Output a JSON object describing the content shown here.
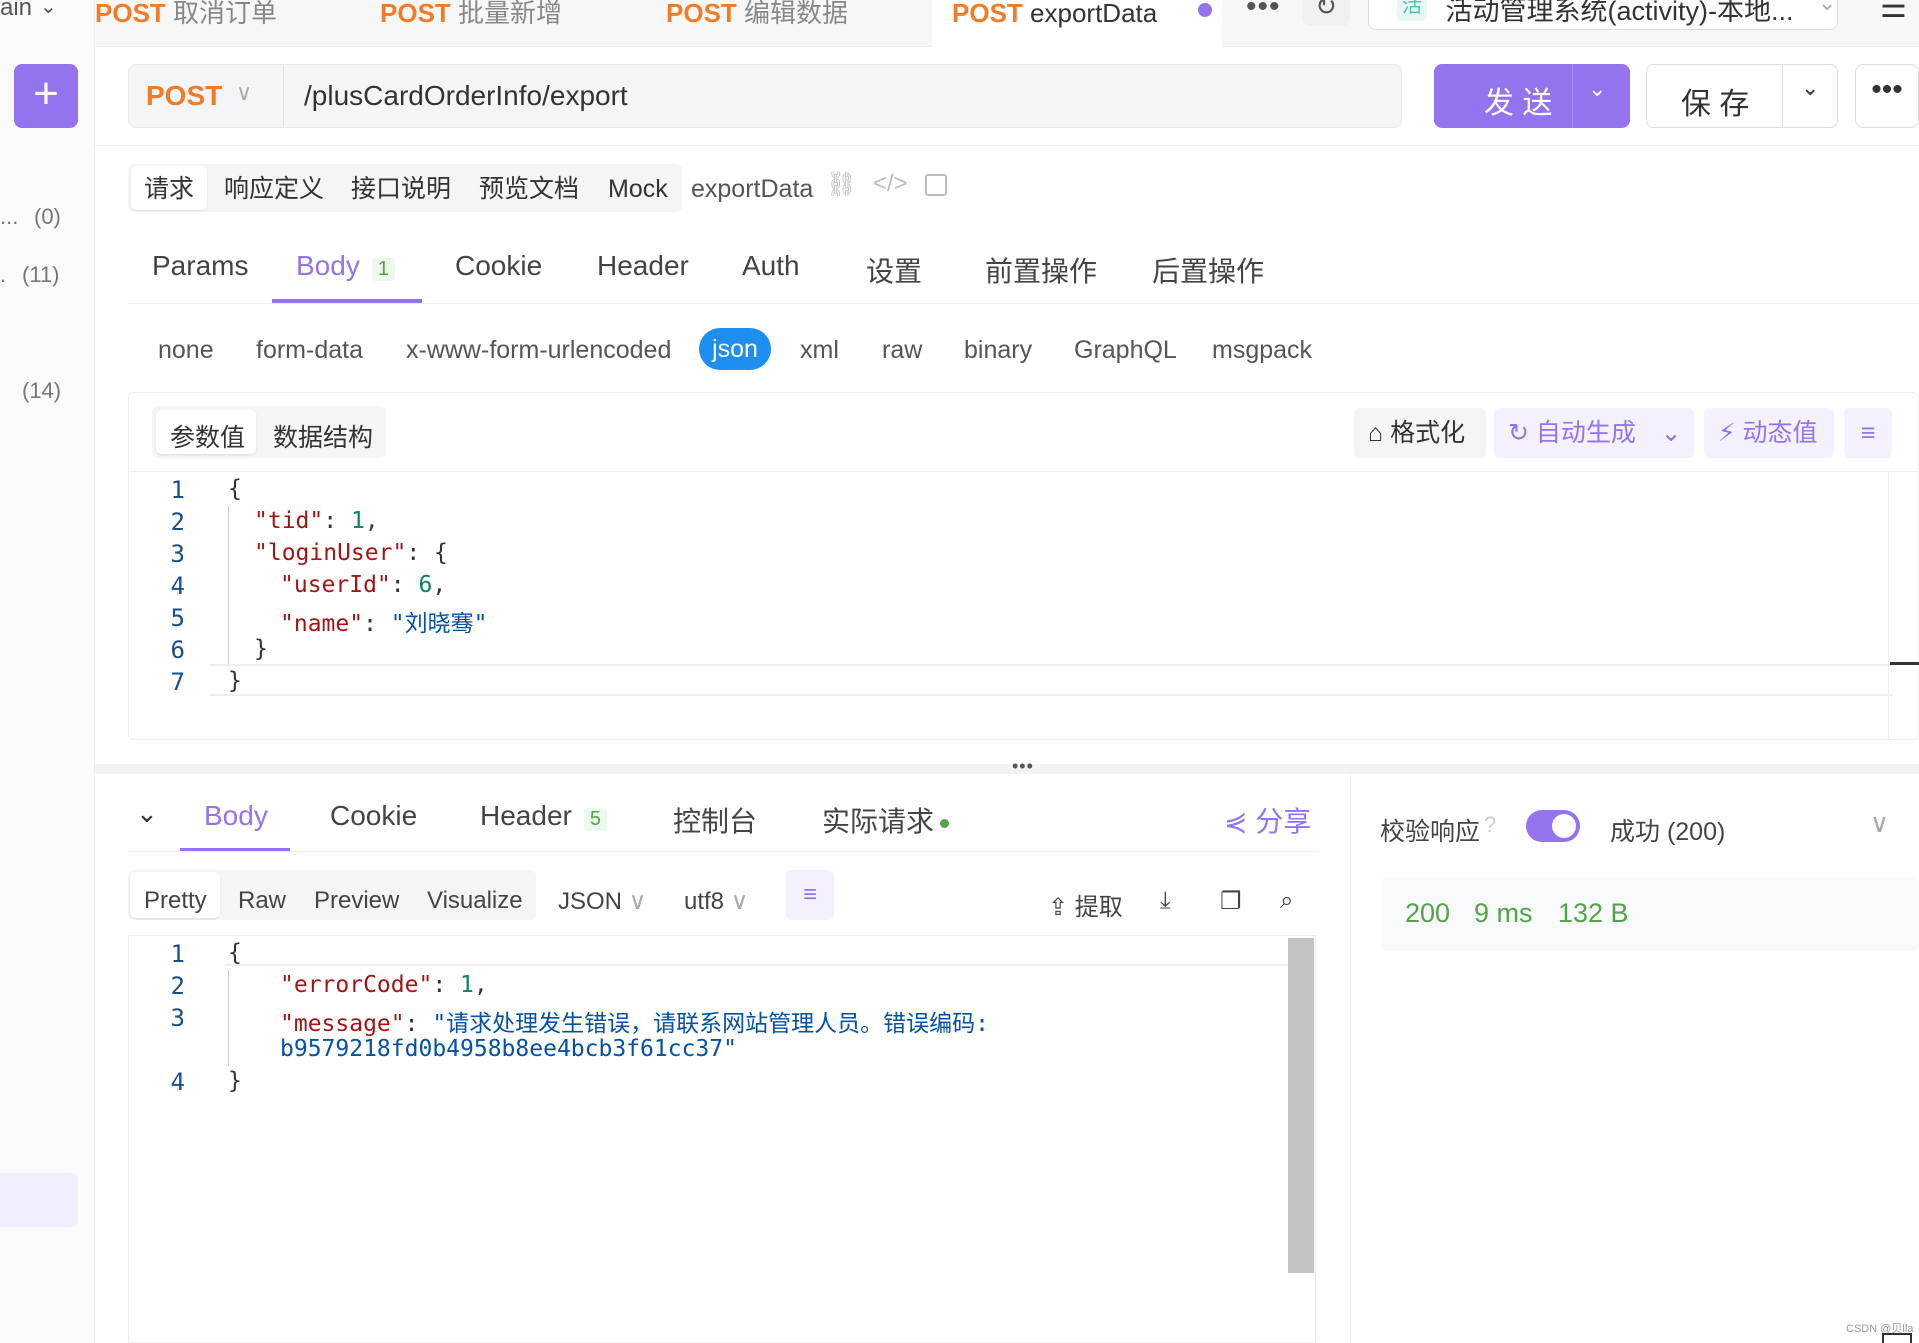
{
  "left": {
    "partial_label": "ain",
    "counts": [
      "(0)",
      "(11)",
      "(14)"
    ],
    "prefixes": [
      "...",
      "."
    ],
    "add_label": "+"
  },
  "tabs": [
    {
      "method": "POST",
      "title": "取消订单"
    },
    {
      "method": "POST",
      "title": "批量新增"
    },
    {
      "method": "POST",
      "title": "编辑数据"
    },
    {
      "method": "POST",
      "title": "exportData"
    }
  ],
  "env": {
    "label": "活动管理系统(activity)-本地...",
    "badge": "活"
  },
  "request": {
    "method": "POST",
    "url": "/plusCardOrderInfo/export",
    "send_label": "发 送",
    "save_label": "保 存"
  },
  "req_tabs": [
    "请求",
    "响应定义",
    "接口说明",
    "预览文档",
    "Mock"
  ],
  "api_name": "exportData",
  "param_tabs": [
    {
      "label": "Params"
    },
    {
      "label": "Body",
      "badge": "1"
    },
    {
      "label": "Cookie"
    },
    {
      "label": "Header"
    },
    {
      "label": "Auth"
    },
    {
      "label": "设置"
    },
    {
      "label": "前置操作"
    },
    {
      "label": "后置操作"
    }
  ],
  "body_types": [
    "none",
    "form-data",
    "x-www-form-urlencoded",
    "json",
    "xml",
    "raw",
    "binary",
    "GraphQL",
    "msgpack"
  ],
  "editor_tabs": [
    "参数值",
    "数据结构"
  ],
  "editor_tools": {
    "format": "格式化",
    "autogen": "自动生成",
    "dynamic": "动态值"
  },
  "request_body_lines": [
    "1",
    "2",
    "3",
    "4",
    "5",
    "6",
    "7"
  ],
  "request_body": {
    "tid_key": "\"tid\"",
    "tid_val": "1",
    "loginUser_key": "\"loginUser\"",
    "userId_key": "\"userId\"",
    "userId_val": "6",
    "name_key": "\"name\"",
    "name_val": "\"刘晓骞\""
  },
  "response_tabs": [
    {
      "label": "Body"
    },
    {
      "label": "Cookie"
    },
    {
      "label": "Header",
      "badge": "5"
    },
    {
      "label": "控制台"
    },
    {
      "label": "实际请求"
    }
  ],
  "share_label": "分享",
  "view_tabs": [
    "Pretty",
    "Raw",
    "Preview",
    "Visualize"
  ],
  "format_select": "JSON",
  "encoding_select": "utf8",
  "extract_label": "提取",
  "response_body_lines": [
    "1",
    "2",
    "3",
    "4"
  ],
  "response_body": {
    "errorCode_key": "\"errorCode\"",
    "errorCode_val": "1",
    "message_key": "\"message\"",
    "message_val1": "\"请求处理发生错误，请联系网站管理人员。错误编码:",
    "message_val2": "b9579218fd0b4958b8ee4bcb3f61cc37\""
  },
  "validate": {
    "label": "校验响应",
    "result": "成功 (200)"
  },
  "status": {
    "code": "200",
    "time": "9 ms",
    "size": "132 B"
  },
  "watermark": "CSDN @贝lla",
  "colors": {
    "accent": "#9373ee",
    "post": "#f07c28",
    "json_pill": "#1e8fef",
    "status_ok": "#52a447"
  }
}
